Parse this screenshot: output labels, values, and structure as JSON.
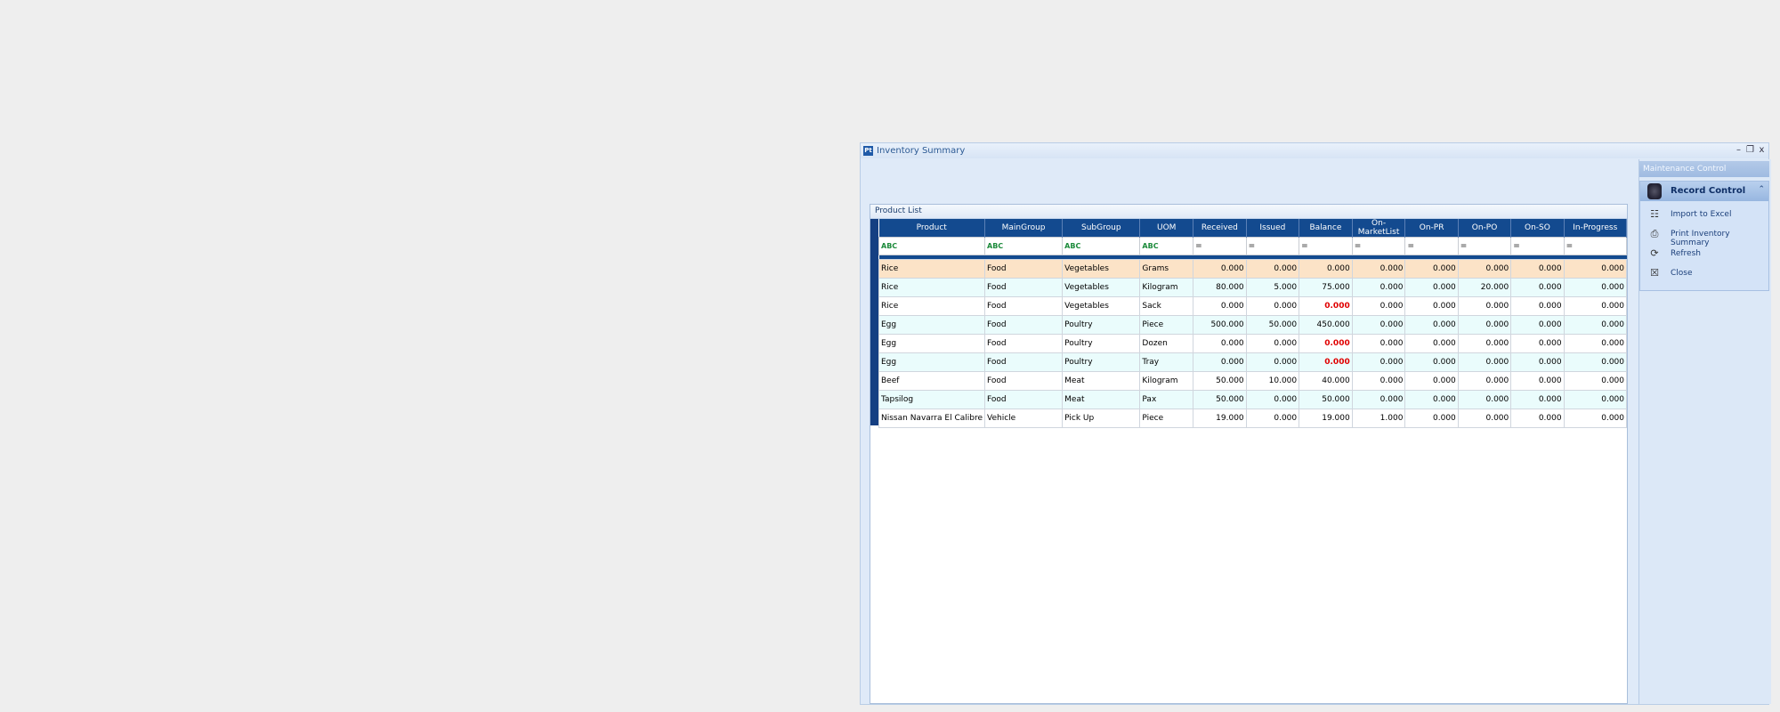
{
  "window": {
    "app_icon_text": "Pt",
    "title": "Inventory Summary",
    "minimize": "–",
    "restore": "❐",
    "close": "x"
  },
  "panel": {
    "title": "Product List"
  },
  "grid": {
    "columns": [
      "Product",
      "MainGroup",
      "SubGroup",
      "UOM",
      "Received",
      "Issued",
      "Balance",
      "On-MarketList",
      "On-PR",
      "On-PO",
      "On-SO",
      "In-Progress"
    ],
    "filter_text_icon": "ABC",
    "filter_eq_icon": "=",
    "rows": [
      {
        "product": "Rice",
        "main": "Food",
        "sub": "Vegetables",
        "uom": "Grams",
        "received": "0.000",
        "issued": "0.000",
        "balance": "0.000",
        "market": "0.000",
        "pr": "0.000",
        "po": "0.000",
        "so": "0.000",
        "progress": "0.000"
      },
      {
        "product": "Rice",
        "main": "Food",
        "sub": "Vegetables",
        "uom": "Kilogram",
        "received": "80.000",
        "issued": "5.000",
        "balance": "75.000",
        "market": "0.000",
        "pr": "0.000",
        "po": "20.000",
        "so": "0.000",
        "progress": "0.000"
      },
      {
        "product": "Rice",
        "main": "Food",
        "sub": "Vegetables",
        "uom": "Sack",
        "received": "0.000",
        "issued": "0.000",
        "balance": "0.000",
        "market": "0.000",
        "pr": "0.000",
        "po": "0.000",
        "so": "0.000",
        "progress": "0.000"
      },
      {
        "product": "Egg",
        "main": "Food",
        "sub": "Poultry",
        "uom": "Piece",
        "received": "500.000",
        "issued": "50.000",
        "balance": "450.000",
        "market": "0.000",
        "pr": "0.000",
        "po": "0.000",
        "so": "0.000",
        "progress": "0.000"
      },
      {
        "product": "Egg",
        "main": "Food",
        "sub": "Poultry",
        "uom": "Dozen",
        "received": "0.000",
        "issued": "0.000",
        "balance": "0.000",
        "market": "0.000",
        "pr": "0.000",
        "po": "0.000",
        "so": "0.000",
        "progress": "0.000"
      },
      {
        "product": "Egg",
        "main": "Food",
        "sub": "Poultry",
        "uom": "Tray",
        "received": "0.000",
        "issued": "0.000",
        "balance": "0.000",
        "market": "0.000",
        "pr": "0.000",
        "po": "0.000",
        "so": "0.000",
        "progress": "0.000"
      },
      {
        "product": "Beef",
        "main": "Food",
        "sub": "Meat",
        "uom": "Kilogram",
        "received": "50.000",
        "issued": "10.000",
        "balance": "40.000",
        "market": "0.000",
        "pr": "0.000",
        "po": "0.000",
        "so": "0.000",
        "progress": "0.000"
      },
      {
        "product": "Tapsilog",
        "main": "Food",
        "sub": "Meat",
        "uom": "Pax",
        "received": "50.000",
        "issued": "0.000",
        "balance": "50.000",
        "market": "0.000",
        "pr": "0.000",
        "po": "0.000",
        "so": "0.000",
        "progress": "0.000"
      },
      {
        "product": "Nissan Navarra El Calibre",
        "main": "Vehicle",
        "sub": "Pick Up",
        "uom": "Piece",
        "received": "19.000",
        "issued": "0.000",
        "balance": "19.000",
        "market": "1.000",
        "pr": "0.000",
        "po": "0.000",
        "so": "0.000",
        "progress": "0.000"
      }
    ]
  },
  "side": {
    "maintenance_title": "Maintenance Control",
    "record_control": {
      "title": "Record Control",
      "collapse_icon": "⌃",
      "items": [
        {
          "label": "Import to Excel",
          "icon": "grid-icon",
          "glyph": "☷"
        },
        {
          "label": "Print Inventory Summary",
          "icon": "printer-icon",
          "glyph": "⎙"
        },
        {
          "label": "Refresh",
          "icon": "refresh-icon",
          "glyph": "⟳"
        },
        {
          "label": "Close",
          "icon": "close-box-icon",
          "glyph": "☒"
        }
      ]
    }
  },
  "colors": {
    "header_bg": "#134a8f",
    "selected_row": "#fce3c7",
    "alt_row": "#eafcfc",
    "zero_balance_text": "#e00000"
  }
}
